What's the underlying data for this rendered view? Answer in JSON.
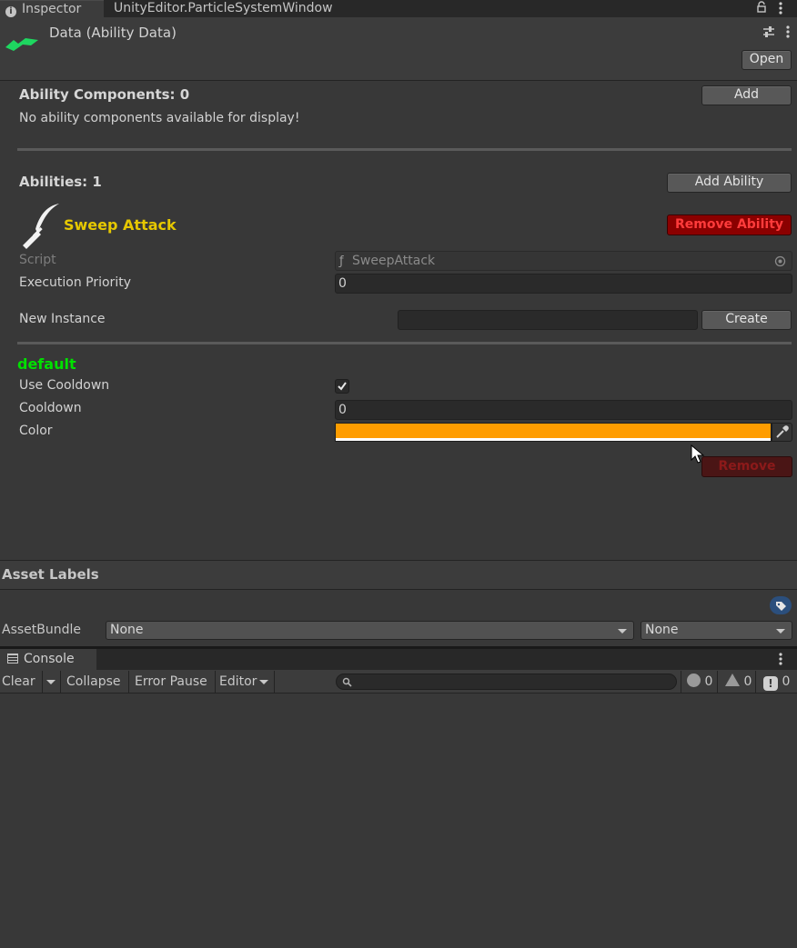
{
  "tabs": {
    "inspector": "Inspector",
    "particle": "UnityEditor.ParticleSystemWindow"
  },
  "header": {
    "title": "Data (Ability Data)",
    "open_button": "Open"
  },
  "ability_components": {
    "title": "Ability Components: 0",
    "add_button": "Add",
    "empty_message": "No ability components available for display!"
  },
  "abilities": {
    "title": "Abilities: 1",
    "add_button": "Add Ability",
    "ability_name": "Sweep Attack",
    "remove_button": "Remove Ability",
    "script_label": "Script",
    "script_value": "SweepAttack",
    "priority_label": "Execution Priority",
    "priority_value": "0",
    "new_instance_label": "New Instance",
    "new_instance_value": "",
    "create_button": "Create"
  },
  "instance": {
    "name": "default",
    "use_cooldown_label": "Use Cooldown",
    "use_cooldown_checked": true,
    "cooldown_label": "Cooldown",
    "cooldown_value": "0",
    "color_label": "Color",
    "color_value": "#ff9d00",
    "remove_button": "Remove"
  },
  "asset_labels": {
    "title": "Asset Labels",
    "assetbundle_label": "AssetBundle",
    "bundle_value": "None",
    "variant_value": "None"
  },
  "console": {
    "tab": "Console",
    "clear": "Clear",
    "collapse": "Collapse",
    "error_pause": "Error Pause",
    "editor": "Editor",
    "search_placeholder": "",
    "log_count": "0",
    "warning_count": "0",
    "error_count": "0"
  },
  "colors": {
    "ability_name": "#e6c800",
    "remove_ability_bg": "#8b0000",
    "remove_ability_text": "#ff3b3b",
    "instance_name": "#00e000",
    "brand_icon": "#1ed760"
  }
}
